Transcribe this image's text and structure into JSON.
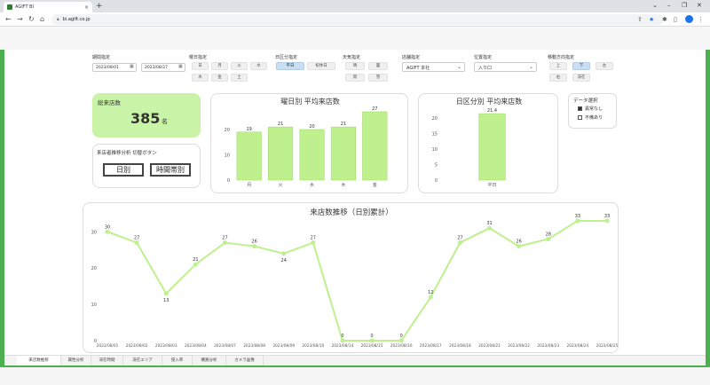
{
  "browser": {
    "tab_title": "AGIFT BI",
    "url": "bi.agift.co.jp"
  },
  "filters": {
    "period_label": "期間指定",
    "date_from": "2023/08/01",
    "date_to": "2023/08/27",
    "weekday_label": "曜日指定",
    "weekdays": [
      "日",
      "月",
      "火",
      "水",
      "木",
      "金",
      "土"
    ],
    "dayclass_label": "日区分指定",
    "dayclass": [
      "平日",
      "祝休日"
    ],
    "weather_label": "天気指定",
    "weather": [
      "晴",
      "曇",
      "雨",
      "雪"
    ],
    "store_label": "店舗指定",
    "store_value": "AGIFT 本社",
    "position_label": "位置指定",
    "position_value": "入り口",
    "direction_label": "移動方向指定",
    "directions": [
      "上",
      "下",
      "左",
      "右",
      "滞在"
    ]
  },
  "kpi": {
    "label": "総来店数",
    "value": "385",
    "unit": "名"
  },
  "switcher": {
    "title": "来店者推移分析 切替ボタン",
    "daily_label": "日別",
    "hourly_label": "時間帯別"
  },
  "data_select": {
    "title": "データ選択",
    "items": [
      "異常なし",
      "不備あり"
    ],
    "checked": [
      true,
      false
    ]
  },
  "colors": {
    "bar": "#bff08e",
    "bar_stroke": "#9ed86a",
    "kpi_bg": "#c9f4a8",
    "line": "#bff08e",
    "brand_green": "#4caf50"
  },
  "chart_data": [
    {
      "type": "bar",
      "title": "曜日別 平均来店数",
      "categories": [
        "月",
        "火",
        "水",
        "木",
        "金"
      ],
      "values": [
        19,
        21,
        20,
        21,
        27
      ],
      "yticks": [
        0,
        10,
        20
      ],
      "ylim": [
        0,
        27
      ]
    },
    {
      "type": "bar",
      "title": "日区分別 平均来店数",
      "categories": [
        "平日"
      ],
      "values": [
        21.4
      ],
      "yticks": [
        0,
        5,
        10,
        15,
        20
      ],
      "ylim": [
        0,
        22
      ]
    },
    {
      "type": "line",
      "title": "来店数推移（日別累計）",
      "categories": [
        "2023/08/01",
        "2023/08/02",
        "2023/08/03",
        "2023/08/04",
        "2023/08/07",
        "2023/08/08",
        "2023/08/09",
        "2023/08/10",
        "2023/08/14",
        "2023/08/15",
        "2023/08/16",
        "2023/08/17",
        "2023/08/18",
        "2023/08/21",
        "2023/08/22",
        "2023/08/23",
        "2023/08/24",
        "2023/08/25"
      ],
      "values": [
        30,
        27,
        13,
        21,
        27,
        26,
        24,
        27,
        0,
        0,
        0,
        12,
        27,
        31,
        26,
        28,
        33,
        33
      ],
      "yticks": [
        0,
        10,
        20,
        30
      ],
      "ylim": [
        0,
        33
      ]
    }
  ],
  "bottom_tabs": [
    "来店数推移",
    "属性分析",
    "滞在時間",
    "滞在エリア",
    "侵入率",
    "購買分析",
    "カメラ画像"
  ]
}
